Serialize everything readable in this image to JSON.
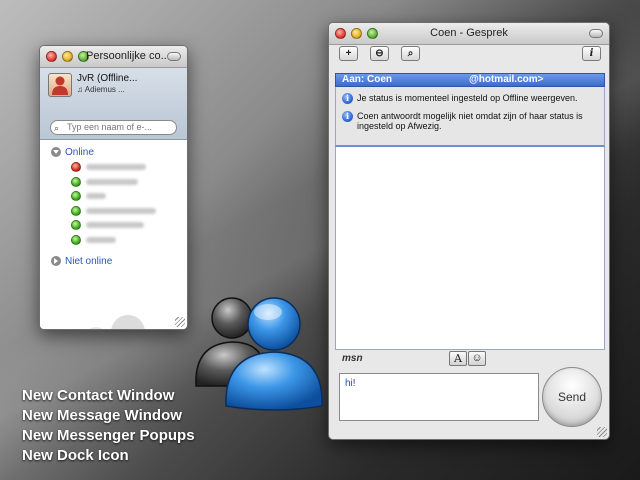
{
  "contacts_window": {
    "title": "Persoonlijke co...",
    "me": {
      "name": "JvR (Offline...",
      "personal_message": "♫ Adiemus ..."
    },
    "search_placeholder": "Typ een naam of e-...",
    "groups": [
      {
        "label": "Online",
        "expanded": true
      },
      {
        "label": "Niet online",
        "expanded": false
      }
    ],
    "contact_statuses": [
      "red",
      "green",
      "green",
      "green",
      "green",
      "green"
    ]
  },
  "conversation_window": {
    "title": "Coen - Gesprek",
    "toolbar_buttons": [
      {
        "icon": "plus-icon",
        "glyph": "+"
      },
      {
        "icon": "block-icon",
        "glyph": "⊖"
      },
      {
        "icon": "search-icon",
        "glyph": "⌕"
      },
      {
        "icon": "info-icon",
        "glyph": "i"
      }
    ],
    "to_label": "Aan: Coen",
    "to_email": "@hotmail.com>",
    "notices": [
      "Je status is momenteel ingesteld op Offline weergeven.",
      "Coen antwoordt mogelijk niet omdat zijn of haar status is ingesteld op Afwezig."
    ],
    "logo": "msn",
    "format_buttons": [
      {
        "icon": "font-icon",
        "glyph": "A"
      },
      {
        "icon": "emoticon-icon",
        "glyph": "☺"
      }
    ],
    "input_value": "hi!",
    "send_label": "Send"
  },
  "captions": [
    "New Contact Window",
    "New Message Window",
    "New Messenger Popups",
    "New Dock Icon"
  ]
}
